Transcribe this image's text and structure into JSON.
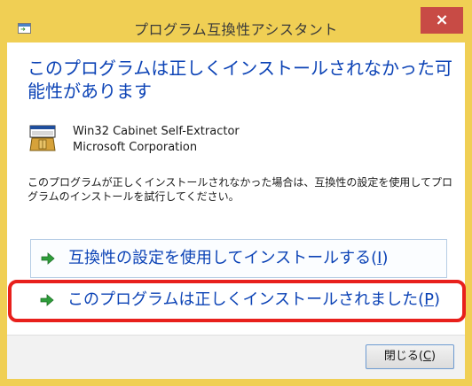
{
  "window": {
    "title": "プログラム互換性アシスタント",
    "close_glyph": "×",
    "accent_color": "#f0cf54",
    "close_color": "#c84b45"
  },
  "headline": "このプログラムは正しくインストールされなかった可能性があります",
  "program": {
    "name": "Win32 Cabinet Self-Extractor",
    "publisher": "Microsoft Corporation",
    "icon": "installer-box-icon"
  },
  "description": "このプログラムが正しくインストールされなかった場合は、互換性の設定を使用してプログラムのインストールを試行してください。",
  "options": [
    {
      "prefix": "互換性の設定を使用してインストールする(",
      "key": "I",
      "suffix": ")",
      "icon": "green-arrow-icon"
    },
    {
      "prefix": "このプログラムは正しくインストールされました(",
      "key": "P",
      "suffix": ")",
      "icon": "green-arrow-icon"
    }
  ],
  "footer": {
    "close_prefix": "閉じる(",
    "close_key": "C",
    "close_suffix": ")"
  },
  "annotation": {
    "highlight_color": "#e8201c"
  }
}
